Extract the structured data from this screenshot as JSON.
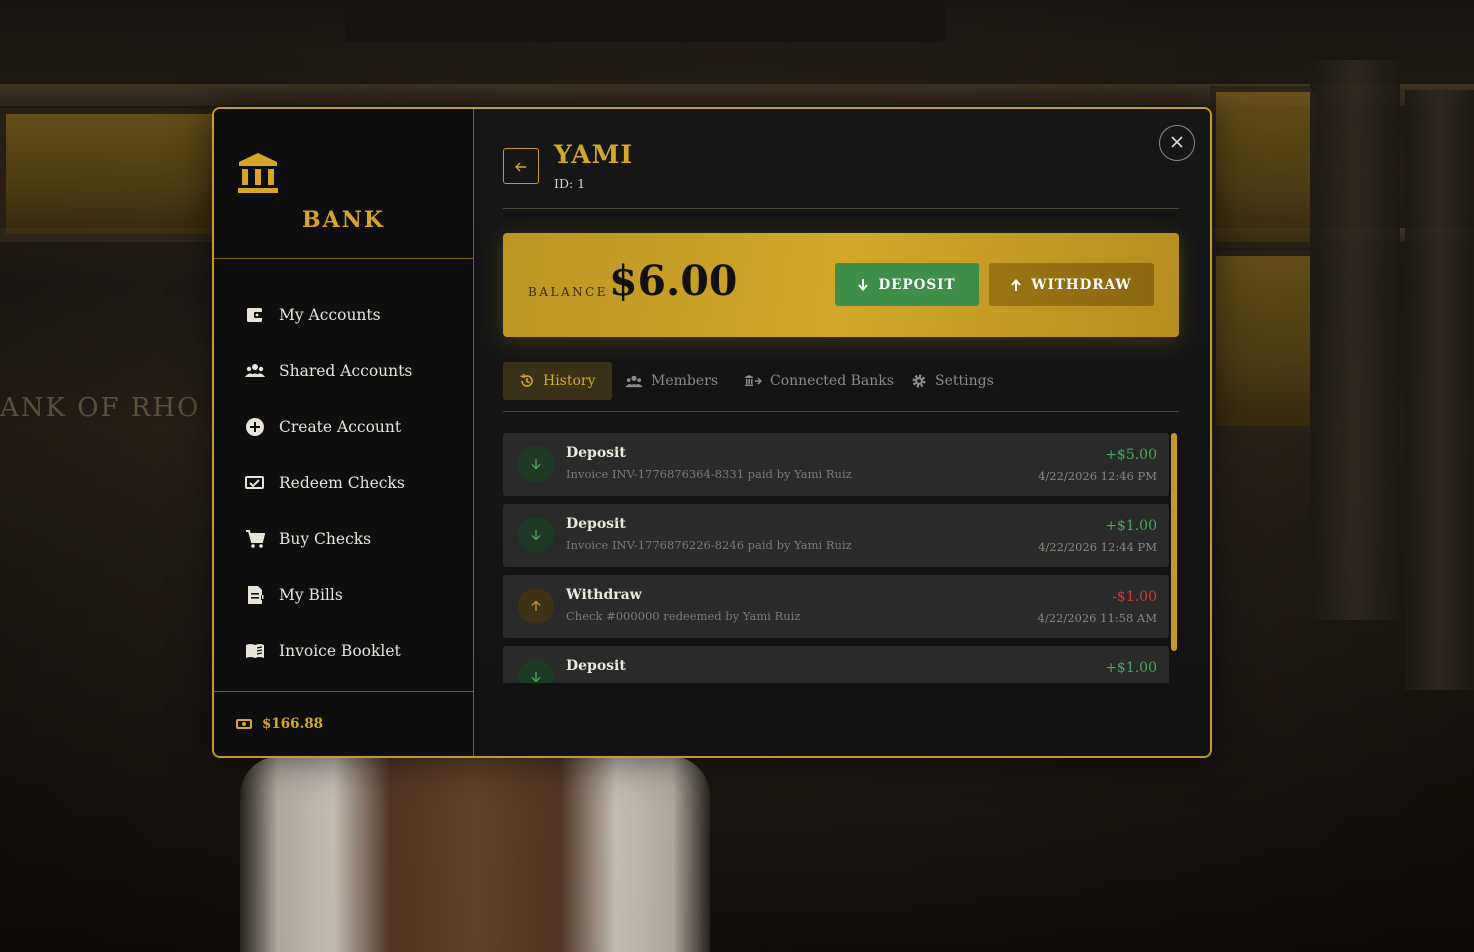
{
  "scene": {
    "sign_text": "ANK OF RHO"
  },
  "sidebar": {
    "brand_title": "BANK",
    "nav": [
      {
        "label": "My Accounts",
        "icon": "wallet-icon"
      },
      {
        "label": "Shared Accounts",
        "icon": "users-icon"
      },
      {
        "label": "Create Account",
        "icon": "plus-circle-icon"
      },
      {
        "label": "Redeem Checks",
        "icon": "check-cash-icon"
      },
      {
        "label": "Buy Checks",
        "icon": "cart-icon"
      },
      {
        "label": "My Bills",
        "icon": "bill-icon"
      },
      {
        "label": "Invoice Booklet",
        "icon": "book-icon"
      }
    ],
    "wallet_cash": "$166.88"
  },
  "account": {
    "name": "YAMI",
    "id_label": "ID:",
    "id_value": "1",
    "balance_label": "BALANCE",
    "balance": "$6.00",
    "deposit_label": "DEPOSIT",
    "withdraw_label": "WITHDRAW"
  },
  "tabs": [
    {
      "label": "History",
      "icon": "history-icon",
      "active": true
    },
    {
      "label": "Members",
      "icon": "users-icon",
      "active": false
    },
    {
      "label": "Connected Banks",
      "icon": "bank-link-icon",
      "active": false
    },
    {
      "label": "Settings",
      "icon": "gear-icon",
      "active": false
    }
  ],
  "history": [
    {
      "type": "Deposit",
      "direction": "in",
      "description": "Invoice INV-1776876364-8331 paid by Yami Ruiz",
      "amount": "+$5.00",
      "date": "4/22/2026 12:46 PM"
    },
    {
      "type": "Deposit",
      "direction": "in",
      "description": "Invoice INV-1776876226-8246 paid by Yami Ruiz",
      "amount": "+$1.00",
      "date": "4/22/2026 12:44 PM"
    },
    {
      "type": "Withdraw",
      "direction": "out",
      "description": "Check #000000 redeemed by Yami Ruiz",
      "amount": "-$1.00",
      "date": "4/22/2026 11:58 AM"
    },
    {
      "type": "Deposit",
      "direction": "in",
      "description": "",
      "amount": "+$1.00",
      "date": ""
    }
  ],
  "colors": {
    "accent_gold": "#d4a72c",
    "deposit_green": "#3e8e4a",
    "positive": "#4ca85a",
    "negative": "#cc3a3a"
  }
}
